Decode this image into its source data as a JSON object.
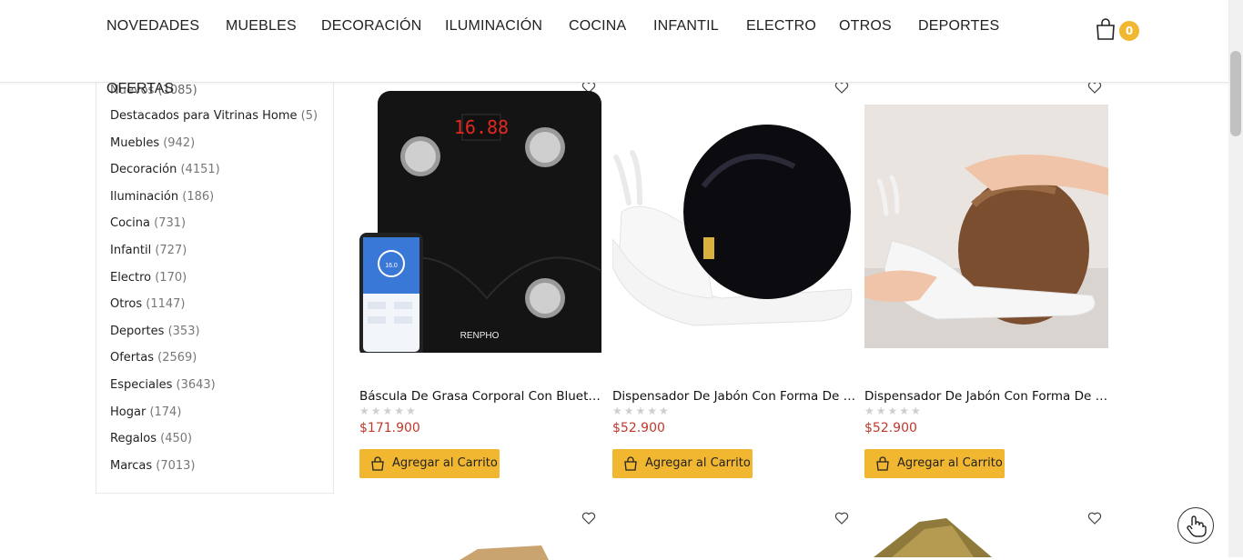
{
  "nav": {
    "items": [
      "NOVEDADES",
      "MUEBLES",
      "DECORACIÓN",
      "ILUMINACIÓN",
      "COCINA",
      "INFANTIL",
      "ELECTRO",
      "OTROS",
      "DEPORTES"
    ],
    "overflow_item": "OFERTAS",
    "cart_count": "0"
  },
  "sidebar": {
    "first_row_text": "Nuevos (1085)",
    "categories": [
      {
        "label": "Destacados para Vitrinas Home",
        "count": "(5)"
      },
      {
        "label": "Muebles",
        "count": "(942)"
      },
      {
        "label": "Decoración",
        "count": "(4151)"
      },
      {
        "label": "Iluminación",
        "count": "(186)"
      },
      {
        "label": "Cocina",
        "count": "(731)"
      },
      {
        "label": "Infantil",
        "count": "(727)"
      },
      {
        "label": "Electro",
        "count": "(170)"
      },
      {
        "label": "Otros",
        "count": "(1147)"
      },
      {
        "label": "Deportes",
        "count": "(353)"
      },
      {
        "label": "Ofertas",
        "count": "(2569)"
      },
      {
        "label": "Especiales",
        "count": "(3643)"
      },
      {
        "label": "Hogar",
        "count": "(174)"
      },
      {
        "label": "Regalos",
        "count": "(450)"
      },
      {
        "label": "Marcas",
        "count": "(7013)"
      }
    ]
  },
  "products": [
    {
      "title": "Báscula De Grasa Corporal Con Bluetooth",
      "price": "$171.900",
      "button": "Agregar al Carrito",
      "rating": 0,
      "scale_display": "16.88",
      "brand": "RENPHO",
      "phone_reading": "16.0"
    },
    {
      "title": "Dispensador De Jabón Con Forma De Caracol",
      "price": "$52.900",
      "button": "Agregar al Carrito",
      "rating": 0
    },
    {
      "title": "Dispensador De Jabón Con Forma De Caracol",
      "price": "$52.900",
      "button": "Agregar al Carrito",
      "rating": 0
    }
  ],
  "icons": {
    "wishlist": "heart-outline-icon",
    "cart": "shopping-bag-icon",
    "fab": "hand-pointer-icon"
  },
  "colors": {
    "accent": "#f2b731",
    "price": "#c0392b"
  }
}
